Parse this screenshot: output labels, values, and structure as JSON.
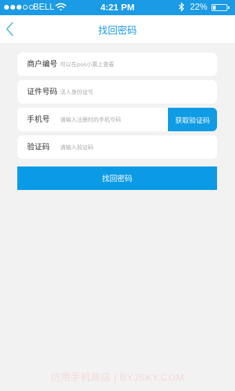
{
  "status_bar": {
    "carrier": "BELL",
    "time": "4:21 PM",
    "battery_percent": "22%",
    "battery_level": 0.22,
    "signal_bars_filled": 3,
    "signal_bars_total": 5
  },
  "nav": {
    "title": "找回密码",
    "back_icon": "chevron-left-icon"
  },
  "form": {
    "merchant": {
      "label": "商户编号",
      "placeholder": "可以在pos小票上查看",
      "value": ""
    },
    "id_number": {
      "label": "证件号码",
      "placeholder": "法人身份证号",
      "value": ""
    },
    "phone": {
      "label": "手机号",
      "placeholder": "请输入注册时的手机号码",
      "value": ""
    },
    "get_code_label": "获取验证码",
    "code": {
      "label": "验证码",
      "placeholder": "请输入验证码",
      "value": ""
    },
    "submit_label": "找回密码"
  },
  "watermark": "仿用手机商店 | BYJSKY.COM",
  "colors": {
    "accent": "#1b9ae6",
    "background": "#f2f2f2",
    "field_background": "#ffffff"
  }
}
